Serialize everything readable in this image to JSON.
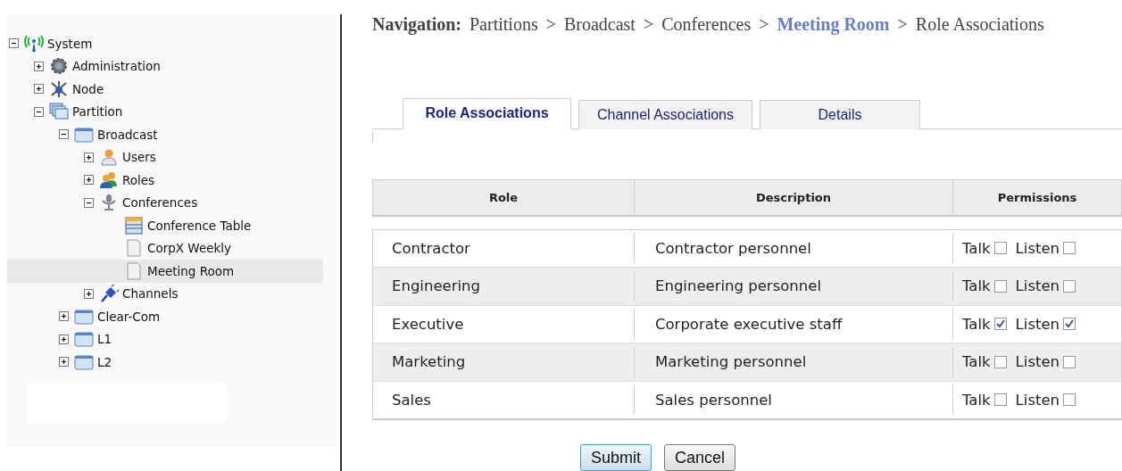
{
  "tree": [
    {
      "label": "System",
      "kind": "antenna",
      "expandable": true,
      "expanded": true,
      "selected": false,
      "children": [
        {
          "label": "Administration",
          "kind": "gear",
          "expandable": true,
          "expanded": false,
          "selected": false
        },
        {
          "label": "Node",
          "kind": "node",
          "expandable": true,
          "expanded": false,
          "selected": false
        },
        {
          "label": "Partition",
          "kind": "partition",
          "expandable": true,
          "expanded": true,
          "selected": false,
          "children": [
            {
              "label": "Broadcast",
              "kind": "window",
              "expandable": true,
              "expanded": true,
              "selected": false,
              "children": [
                {
                  "label": "Users",
                  "kind": "user",
                  "expandable": true,
                  "expanded": false,
                  "selected": false
                },
                {
                  "label": "Roles",
                  "kind": "users",
                  "expandable": true,
                  "expanded": false,
                  "selected": false
                },
                {
                  "label": "Conferences",
                  "kind": "microphone",
                  "expandable": true,
                  "expanded": true,
                  "selected": false,
                  "children": [
                    {
                      "label": "Conference Table",
                      "kind": "table",
                      "expandable": false,
                      "selected": false
                    },
                    {
                      "label": "CorpX Weekly",
                      "kind": "document",
                      "expandable": false,
                      "selected": false
                    },
                    {
                      "label": "Meeting Room",
                      "kind": "document",
                      "expandable": false,
                      "selected": true
                    }
                  ]
                },
                {
                  "label": "Channels",
                  "kind": "plug",
                  "expandable": true,
                  "expanded": false,
                  "selected": false
                }
              ]
            },
            {
              "label": "Clear-Com",
              "kind": "window",
              "expandable": true,
              "expanded": false,
              "selected": false
            },
            {
              "label": "L1",
              "kind": "window",
              "expandable": true,
              "expanded": false,
              "selected": false
            },
            {
              "label": "L2",
              "kind": "window",
              "expandable": true,
              "expanded": false,
              "selected": false
            }
          ]
        }
      ]
    }
  ],
  "breadcrumb": {
    "label": "Navigation:",
    "items": [
      {
        "text": "Partitions",
        "current": false
      },
      {
        "text": "Broadcast",
        "current": false
      },
      {
        "text": "Conferences",
        "current": false
      },
      {
        "text": "Meeting Room",
        "current": true
      },
      {
        "text": "Role Associations",
        "current": false
      }
    ],
    "separator": ">"
  },
  "tabs": [
    {
      "label": "Role Associations",
      "selected": true
    },
    {
      "label": "Channel Associations",
      "selected": false
    },
    {
      "label": "Details",
      "selected": false
    }
  ],
  "table": {
    "columns": [
      "Role",
      "Description",
      "Permissions"
    ],
    "rows": [
      {
        "role": "Contractor",
        "description": "Contractor personnel",
        "talk": {
          "label": "Talk",
          "checked": false
        },
        "listen": {
          "label": "Listen",
          "checked": false
        }
      },
      {
        "role": "Engineering",
        "description": "Engineering personnel",
        "talk": {
          "label": "Talk",
          "checked": false
        },
        "listen": {
          "label": "Listen",
          "checked": false
        }
      },
      {
        "role": "Executive",
        "description": "Corporate executive staff",
        "talk": {
          "label": "Talk",
          "checked": true
        },
        "listen": {
          "label": "Listen",
          "checked": true
        }
      },
      {
        "role": "Marketing",
        "description": "Marketing personnel",
        "talk": {
          "label": "Talk",
          "checked": false
        },
        "listen": {
          "label": "Listen",
          "checked": false
        }
      },
      {
        "role": "Sales",
        "description": "Sales personnel",
        "talk": {
          "label": "Talk",
          "checked": false
        },
        "listen": {
          "label": "Listen",
          "checked": false
        }
      }
    ]
  },
  "buttons": [
    {
      "label": "Submit",
      "primary": true
    },
    {
      "label": "Cancel",
      "primary": false
    }
  ]
}
